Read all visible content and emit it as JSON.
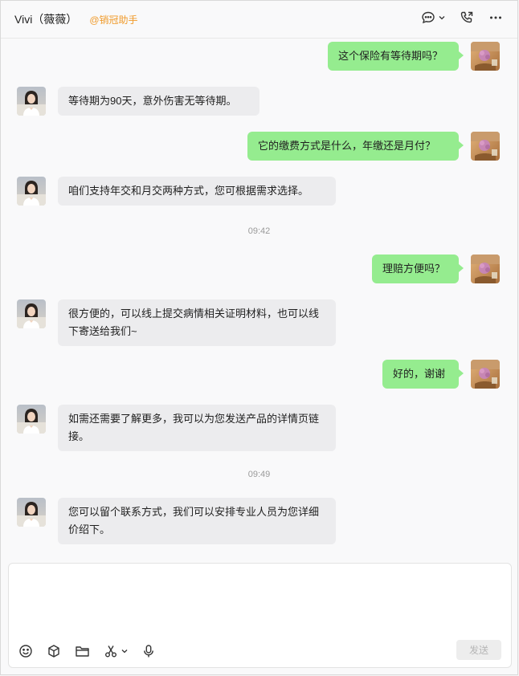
{
  "header": {
    "title": "Vivi（薇薇）",
    "tag": "@销冠助手"
  },
  "messages": [
    {
      "side": "out",
      "text": "这个保险有等待期吗？"
    },
    {
      "side": "in",
      "text": "等待期为90天，意外伤害无等待期。"
    },
    {
      "side": "out",
      "text": "它的缴费方式是什么，年缴还是月付？"
    },
    {
      "side": "in",
      "text": "咱们支持年交和月交两种方式，您可根据需求选择。"
    },
    {
      "side": "time",
      "text": "09:42"
    },
    {
      "side": "out",
      "text": "理赔方便吗？"
    },
    {
      "side": "in",
      "text": "很方便的，可以线上提交病情相关证明材料，也可以线下寄送给我们~"
    },
    {
      "side": "out",
      "text": "好的，谢谢"
    },
    {
      "side": "in",
      "text": "如需还需要了解更多，我可以为您发送产品的详情页链接。"
    },
    {
      "side": "time",
      "text": "09:49"
    },
    {
      "side": "in",
      "text": "您可以留个联系方式，我们可以安排专业人员为您详细价绍下。"
    }
  ],
  "composer": {
    "send_label": "发送",
    "tools": [
      "emoji-icon",
      "package-icon",
      "folder-icon",
      "scissors-icon",
      "microphone-icon"
    ]
  },
  "header_icons": [
    "chat-bubble-icon",
    "phone-icon",
    "more-icon"
  ],
  "colors": {
    "outgoing_bubble": "#95ec8f",
    "incoming_bubble": "#ececee",
    "tag": "#f09a2a"
  }
}
